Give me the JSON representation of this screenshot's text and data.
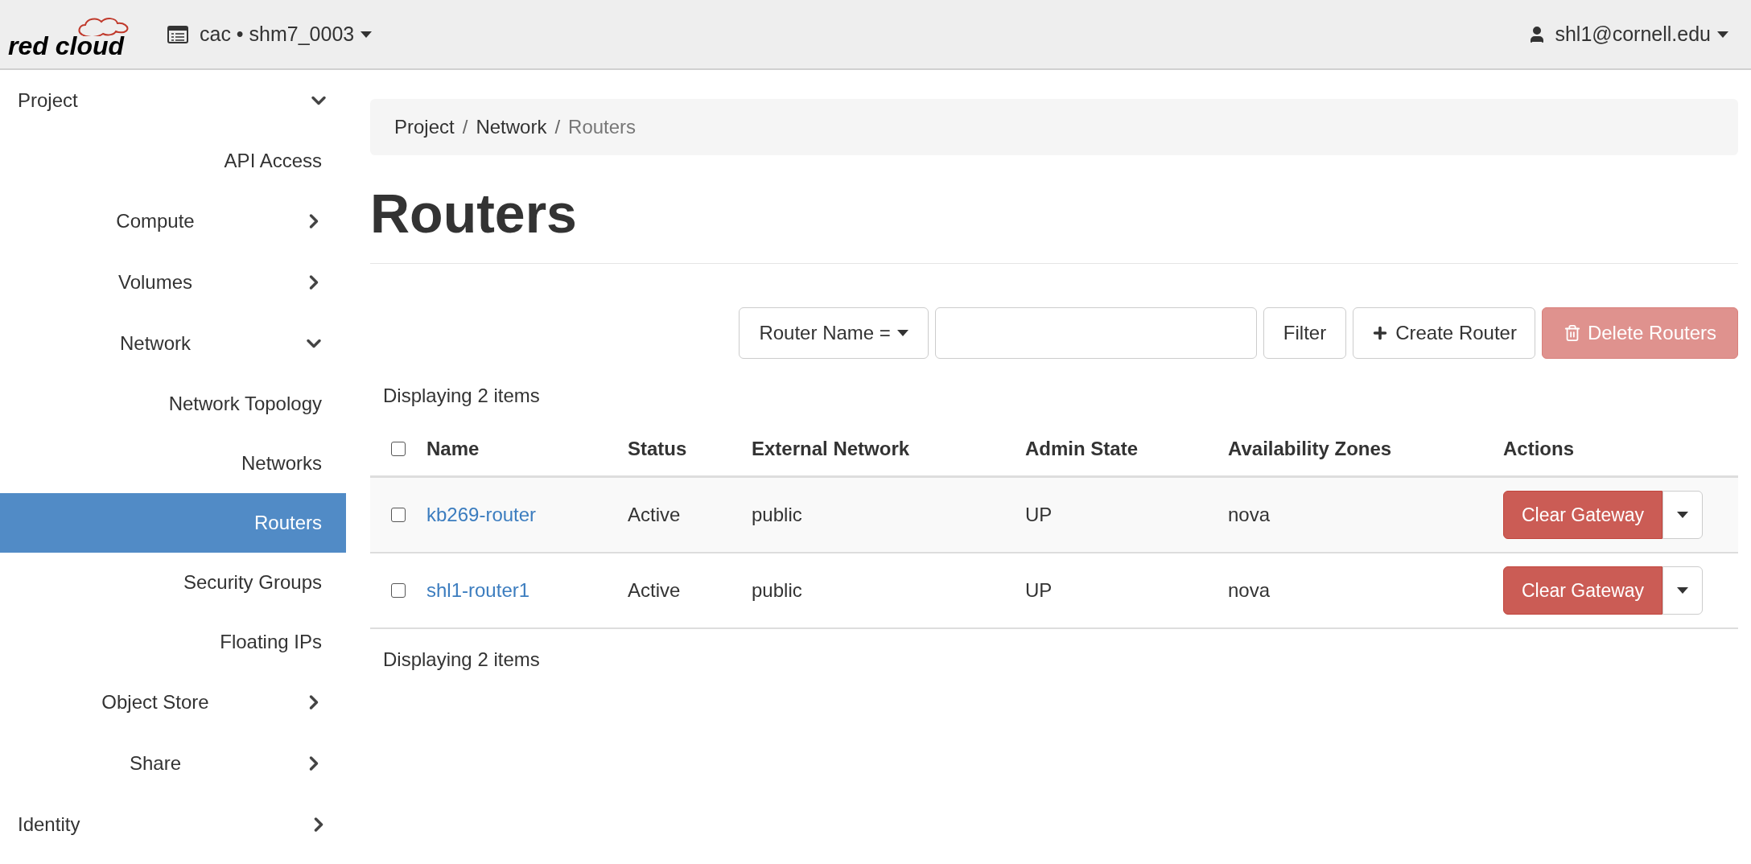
{
  "header": {
    "logo": "red cloud",
    "project_menu": "cac • shm7_0003",
    "user_menu": "shl1@cornell.edu"
  },
  "sidebar": {
    "items": [
      {
        "kind": "group",
        "label": "Project",
        "expanded": true,
        "children": [
          {
            "label": "API Access",
            "selected": false
          },
          {
            "kind": "group",
            "label": "Compute",
            "expanded": false
          },
          {
            "kind": "group",
            "label": "Volumes",
            "expanded": false
          },
          {
            "kind": "group",
            "label": "Network",
            "expanded": true,
            "children": [
              {
                "label": "Network Topology",
                "selected": false
              },
              {
                "label": "Networks",
                "selected": false
              },
              {
                "label": "Routers",
                "selected": true
              },
              {
                "label": "Security Groups",
                "selected": false
              },
              {
                "label": "Floating IPs",
                "selected": false
              }
            ]
          },
          {
            "kind": "group",
            "label": "Object Store",
            "expanded": false
          },
          {
            "kind": "group",
            "label": "Share",
            "expanded": false
          }
        ]
      },
      {
        "kind": "group",
        "label": "Identity",
        "expanded": false
      }
    ]
  },
  "breadcrumb": [
    "Project",
    "/",
    "Network",
    "/",
    "Routers"
  ],
  "page_title": "Routers",
  "toolbar": {
    "filter_field": "Router Name =",
    "filter_button": "Filter",
    "create_button": "Create Router",
    "delete_button": {
      "label": "Delete Routers",
      "disabled": true
    }
  },
  "table": {
    "count_top": "Displaying 2 items",
    "columns": [
      "Name",
      "Status",
      "External Network",
      "Admin State",
      "Availability Zones",
      "Actions"
    ],
    "header_checked": false,
    "rows": [
      {
        "checked": false,
        "name": "kb269-router",
        "status": "Active",
        "external_network": "public",
        "admin_state": "UP",
        "availability_zones": "nova",
        "action": "Clear Gateway"
      },
      {
        "checked": false,
        "name": "shl1-router1",
        "status": "Active",
        "external_network": "public",
        "admin_state": "UP",
        "availability_zones": "nova",
        "action": "Clear Gateway"
      }
    ],
    "count_bottom": "Displaying 2 items"
  }
}
